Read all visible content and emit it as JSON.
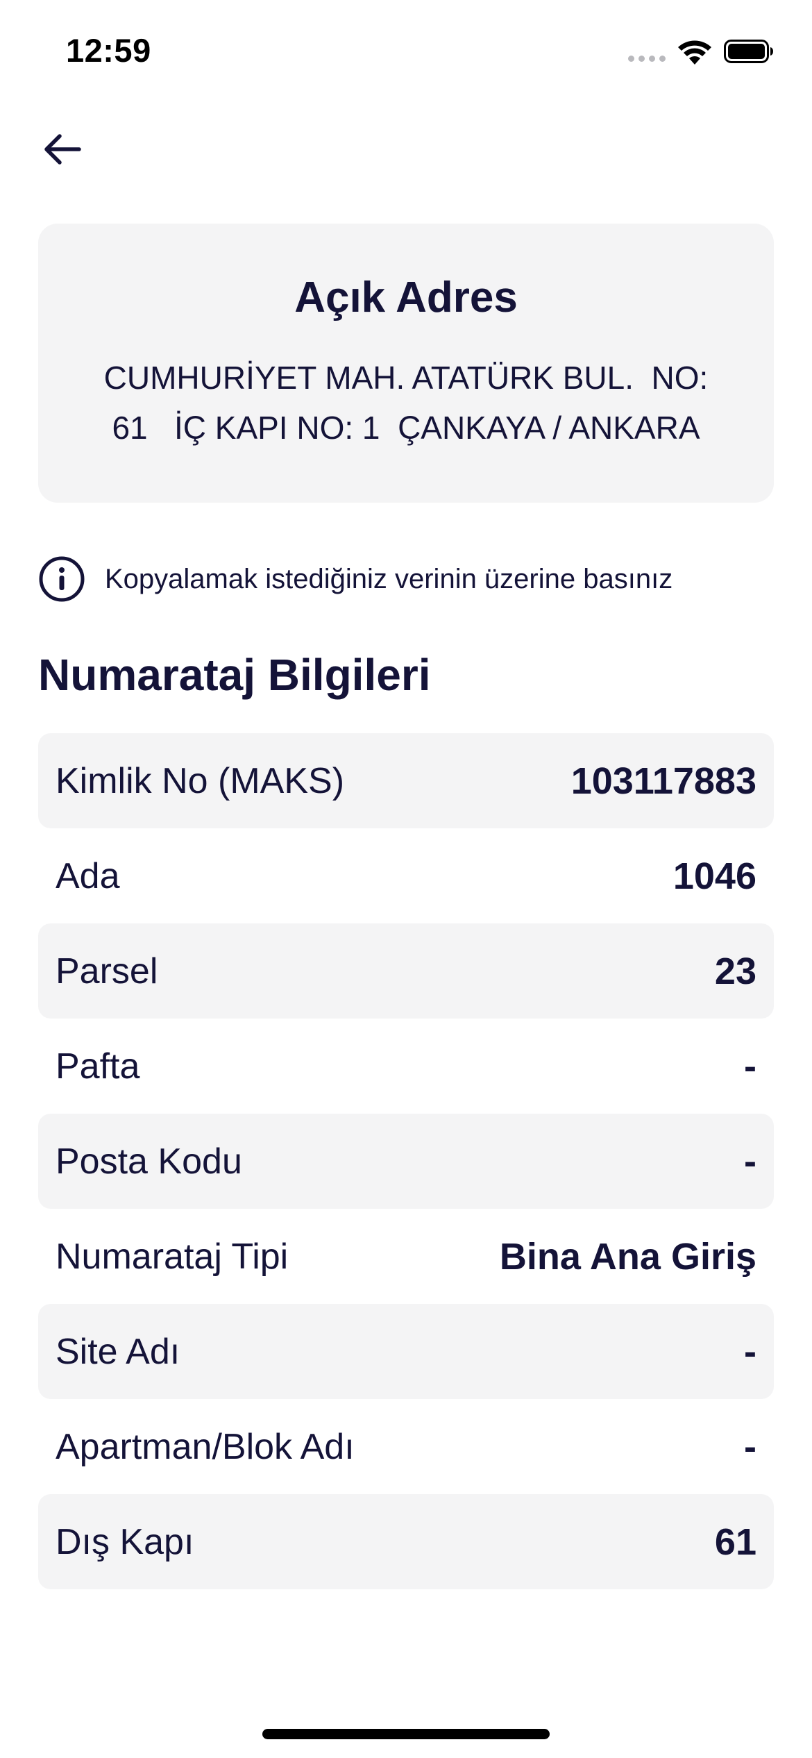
{
  "status_bar": {
    "time": "12:59"
  },
  "address_card": {
    "title": "Açık Adres",
    "address": "CUMHURİYET MAH. ATATÜRK BUL.  NO:\n61   İÇ KAPI NO: 1  ÇANKAYA / ANKARA"
  },
  "hint": {
    "text": "Kopyalamak istediğiniz verinin üzerine basınız",
    "icon": "info-icon"
  },
  "section": {
    "title": "Numarataj Bilgileri"
  },
  "rows": [
    {
      "label": "Kimlik No (MAKS)",
      "value": "103117883"
    },
    {
      "label": "Ada",
      "value": "1046"
    },
    {
      "label": "Parsel",
      "value": "23"
    },
    {
      "label": "Pafta",
      "value": "-"
    },
    {
      "label": "Posta Kodu",
      "value": "-"
    },
    {
      "label": "Numarataj Tipi",
      "value": "Bina Ana Giriş"
    },
    {
      "label": "Site Adı",
      "value": "-"
    },
    {
      "label": "Apartman/Blok Adı",
      "value": "-"
    },
    {
      "label": "Dış Kapı",
      "value": "61"
    }
  ],
  "colors": {
    "text": "#141338",
    "card_background": "#f4f4f5"
  }
}
